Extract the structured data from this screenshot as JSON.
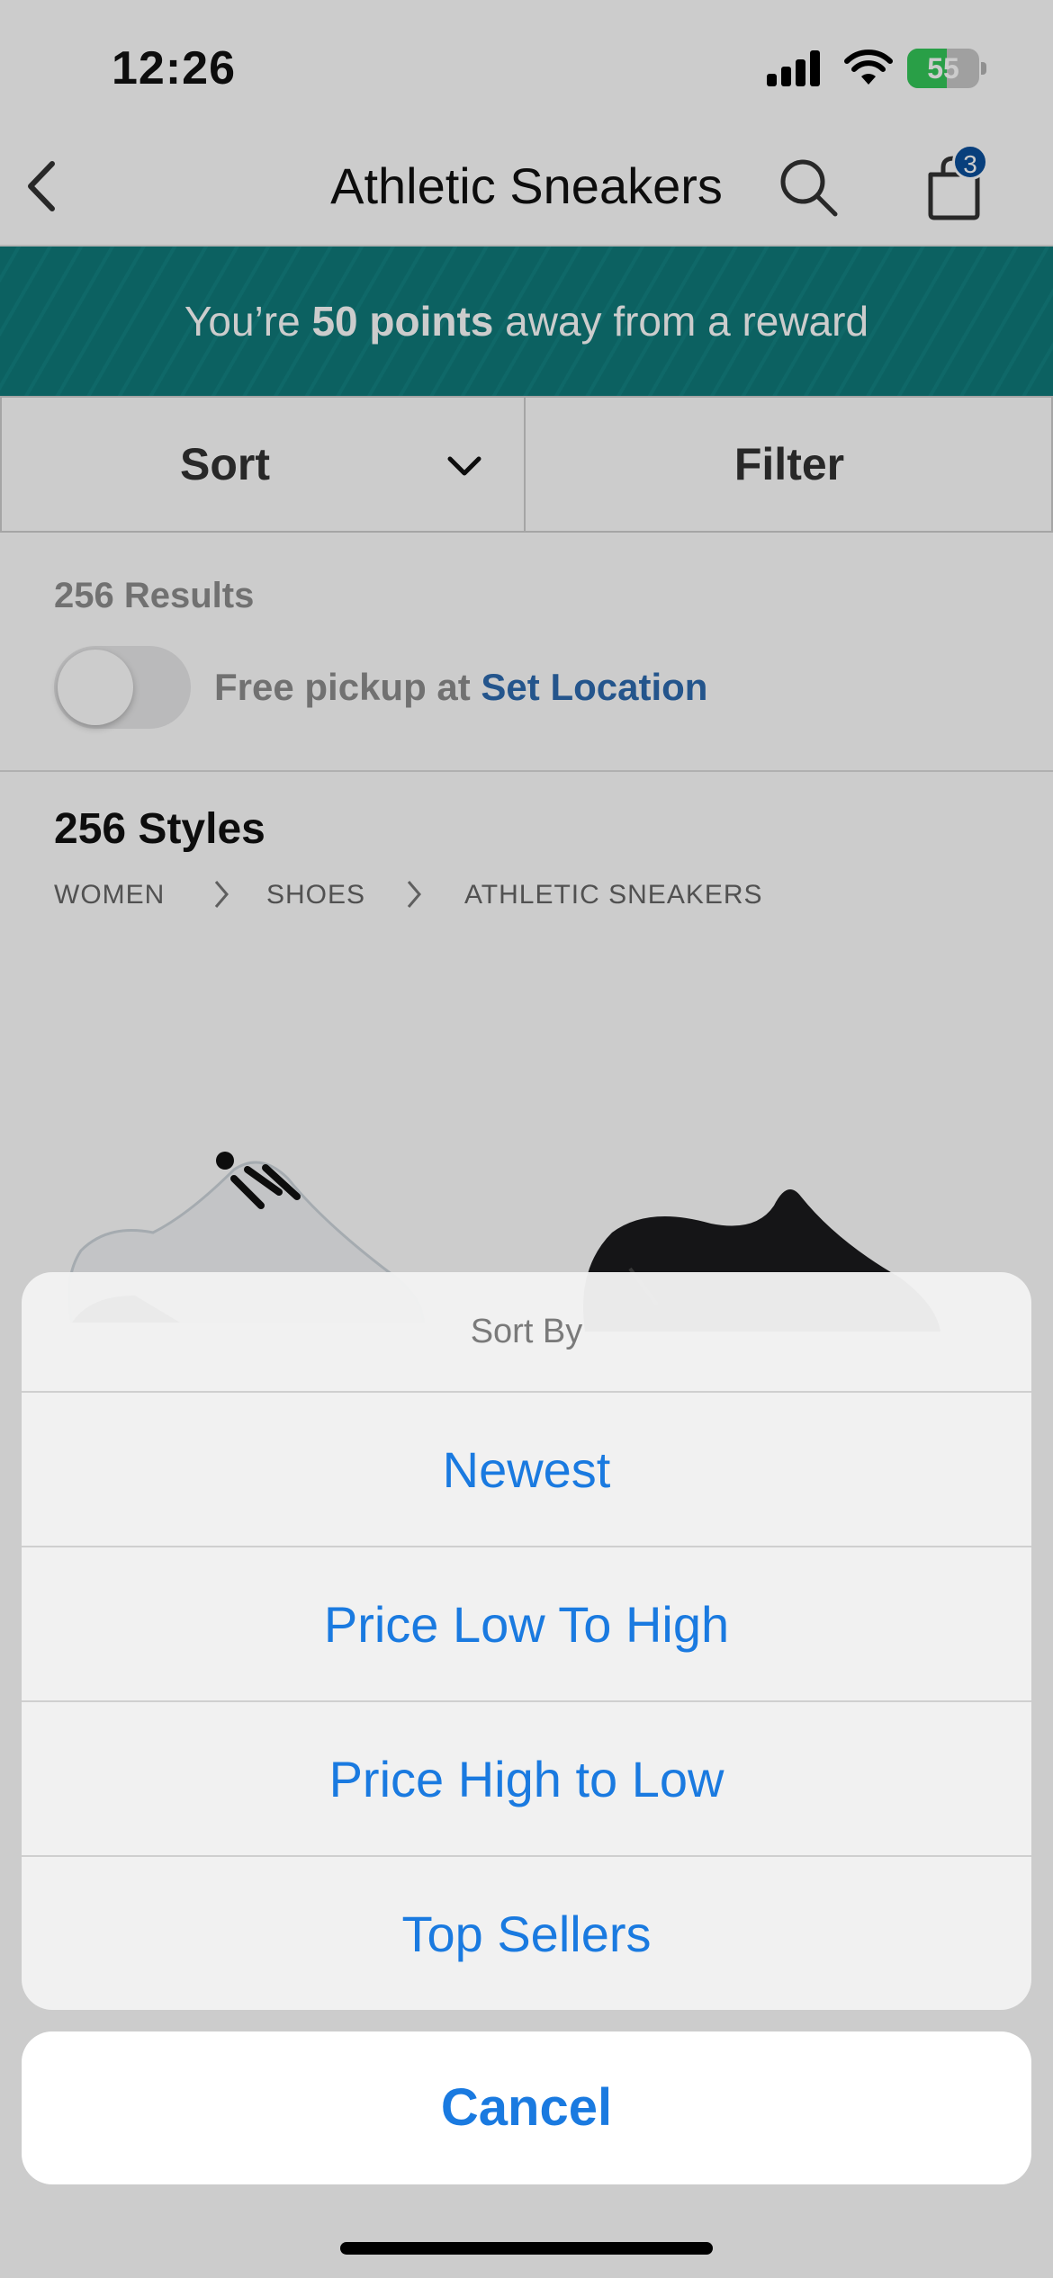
{
  "status_bar": {
    "time": "12:26",
    "battery_percent": "55"
  },
  "nav": {
    "title": "Athletic Sneakers",
    "cart_count": "3"
  },
  "banner": {
    "prefix": "You’re ",
    "points": "50 points",
    "suffix": " away from a reward"
  },
  "toolbar": {
    "sort_label": "Sort",
    "filter_label": "Filter"
  },
  "results": {
    "count_label": "256 Results",
    "pickup_text": "Free pickup at ",
    "pickup_link": "Set Location",
    "free_pickup_enabled": false
  },
  "listing": {
    "styles_label": "256 Styles",
    "breadcrumb": [
      "WOMEN",
      "SHOES",
      "ATHLETIC SNEAKERS"
    ]
  },
  "action_sheet": {
    "title": "Sort By",
    "options": [
      "Newest",
      "Price Low To High",
      "Price High to Low",
      "Top Sellers"
    ],
    "cancel_label": "Cancel"
  },
  "colors": {
    "banner": "#0f7a7a",
    "link": "#2e6bb0",
    "action": "#1a7ae0",
    "badge": "#0b4f9c",
    "battery": "#34c759"
  }
}
